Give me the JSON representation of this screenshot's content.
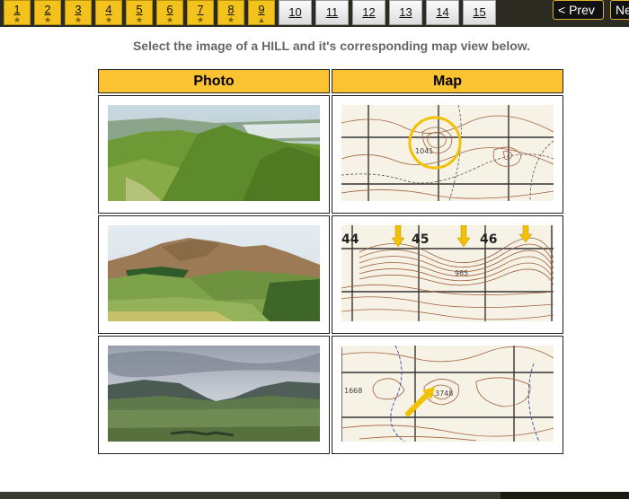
{
  "nav": {
    "pages": [
      {
        "label": "1",
        "state": "done"
      },
      {
        "label": "2",
        "state": "done"
      },
      {
        "label": "3",
        "state": "done"
      },
      {
        "label": "4",
        "state": "done"
      },
      {
        "label": "5",
        "state": "done"
      },
      {
        "label": "6",
        "state": "done"
      },
      {
        "label": "7",
        "state": "done"
      },
      {
        "label": "8",
        "state": "done"
      },
      {
        "label": "9",
        "state": "current"
      },
      {
        "label": "10",
        "state": "todo"
      },
      {
        "label": "11",
        "state": "todo"
      },
      {
        "label": "12",
        "state": "todo"
      },
      {
        "label": "13",
        "state": "todo"
      },
      {
        "label": "14",
        "state": "todo"
      },
      {
        "label": "15",
        "state": "todo"
      }
    ],
    "done_mark": "★",
    "current_mark": "▲",
    "prev_label": "< Prev",
    "next_label": "Next"
  },
  "instruction": "Select the image of a HILL and it's corresponding map view below.",
  "table": {
    "photo_header": "Photo",
    "map_header": "Map"
  },
  "maps": {
    "row1": {
      "elevation": "1041"
    },
    "row2": {
      "grid_labels": [
        "44",
        "45",
        "46"
      ],
      "elevation": "985"
    },
    "row3": {
      "grid_label": "1668",
      "elevation": "3748"
    }
  },
  "colors": {
    "accent": "#fbc232",
    "nav_bg": "#2b2b22",
    "contour": "#9a5a3a",
    "marker": "#f2c200"
  }
}
